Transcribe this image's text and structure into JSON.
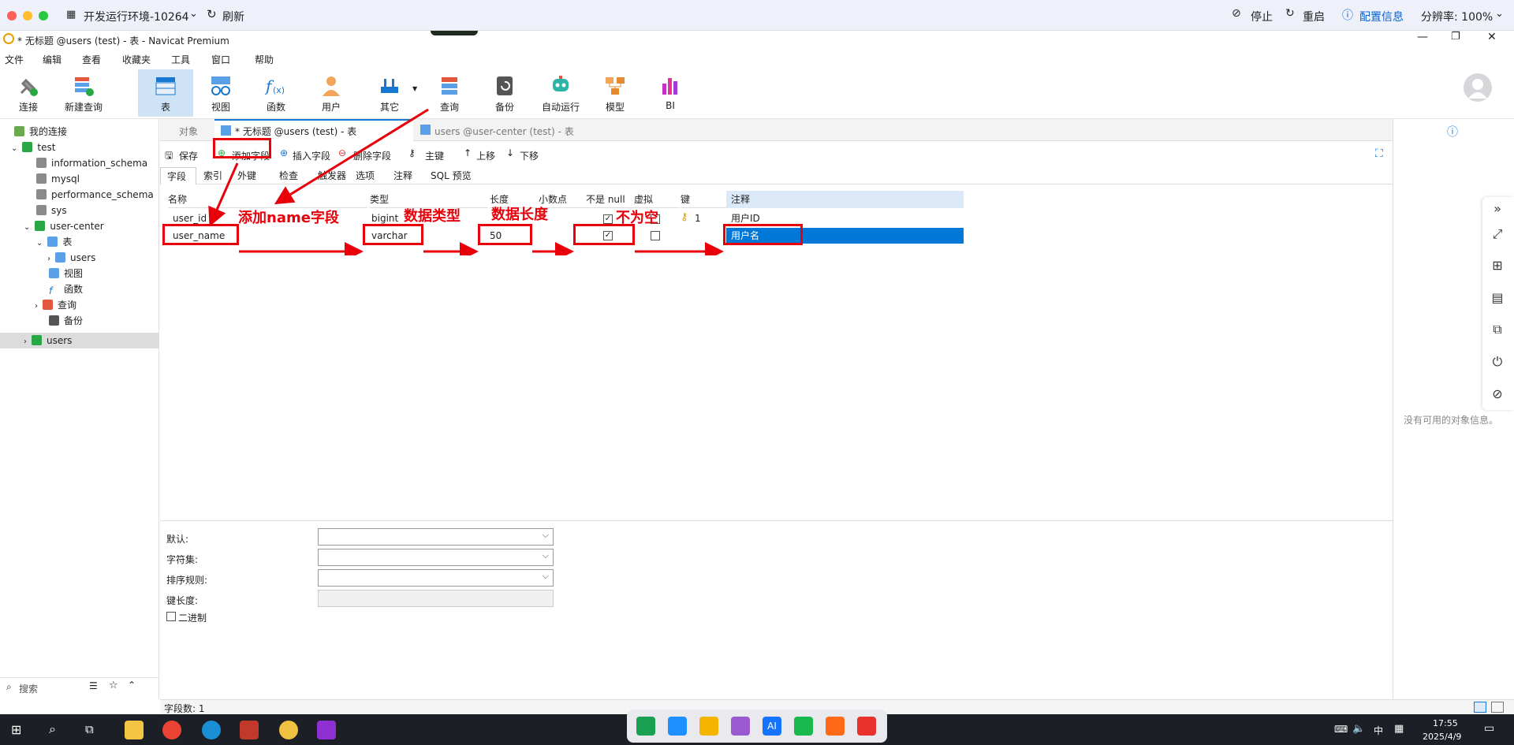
{
  "remote": {
    "env_title": "开发运行环境-10264",
    "refresh": "刷新",
    "stop": "停止",
    "restart": "重启",
    "config": "配置信息",
    "resolution": "分辨率: 100%"
  },
  "window": {
    "title": "* 无标题 @users (test) - 表 - Navicat Premium"
  },
  "menu": [
    "文件",
    "编辑",
    "查看",
    "收藏夹",
    "工具",
    "窗口",
    "帮助"
  ],
  "toolbar": [
    "连接",
    "新建查询",
    "表",
    "视图",
    "函数",
    "用户",
    "其它",
    "查询",
    "备份",
    "自动运行",
    "模型",
    "BI"
  ],
  "sidebar": {
    "root": "我的连接",
    "items": [
      "test",
      "information_schema",
      "mysql",
      "performance_schema",
      "sys",
      "user-center",
      "表",
      "users",
      "视图",
      "函数",
      "查询",
      "备份",
      "users"
    ],
    "search_placeholder": "搜索"
  },
  "tabs": {
    "objects": "对象",
    "active": "* 无标题 @users (test) - 表",
    "other": "users @user-center (test) - 表"
  },
  "editor_toolbar": [
    "保存",
    "添加字段",
    "插入字段",
    "删除字段",
    "主键",
    "上移",
    "下移"
  ],
  "subtabs": [
    "字段",
    "索引",
    "外键",
    "检查",
    "触发器",
    "选项",
    "注释",
    "SQL 预览"
  ],
  "grid": {
    "columns": [
      "名称",
      "类型",
      "长度",
      "小数点",
      "不是 null",
      "虚拟",
      "键",
      "注释"
    ],
    "rows": [
      {
        "name": "user_id",
        "type": "bigint",
        "length": "",
        "decimal": "",
        "not_null": true,
        "virtual": false,
        "key": "1",
        "comment": "用户ID"
      },
      {
        "name": "user_name",
        "type": "varchar",
        "length": "50",
        "decimal": "",
        "not_null": true,
        "virtual": false,
        "key": "",
        "comment": "用户名"
      }
    ]
  },
  "annotations": {
    "add_name": "添加name字段",
    "data_type": "数据类型",
    "data_length": "数据长度",
    "not_null": "不为空"
  },
  "props": {
    "default": "默认:",
    "charset": "字符集:",
    "collation": "排序规则:",
    "key_length": "键长度:",
    "binary": "二进制"
  },
  "right_panel": {
    "empty": "没有可用的对象信息。"
  },
  "status": {
    "field_count": "字段数: 1"
  },
  "taskbar": {
    "time": "17:55",
    "date": "2025/4/9",
    "lang": "中"
  },
  "colors": {
    "accent_blue": "#0a64d2",
    "annotation_red": "#e8000b",
    "selected_row": "#0078d7"
  }
}
